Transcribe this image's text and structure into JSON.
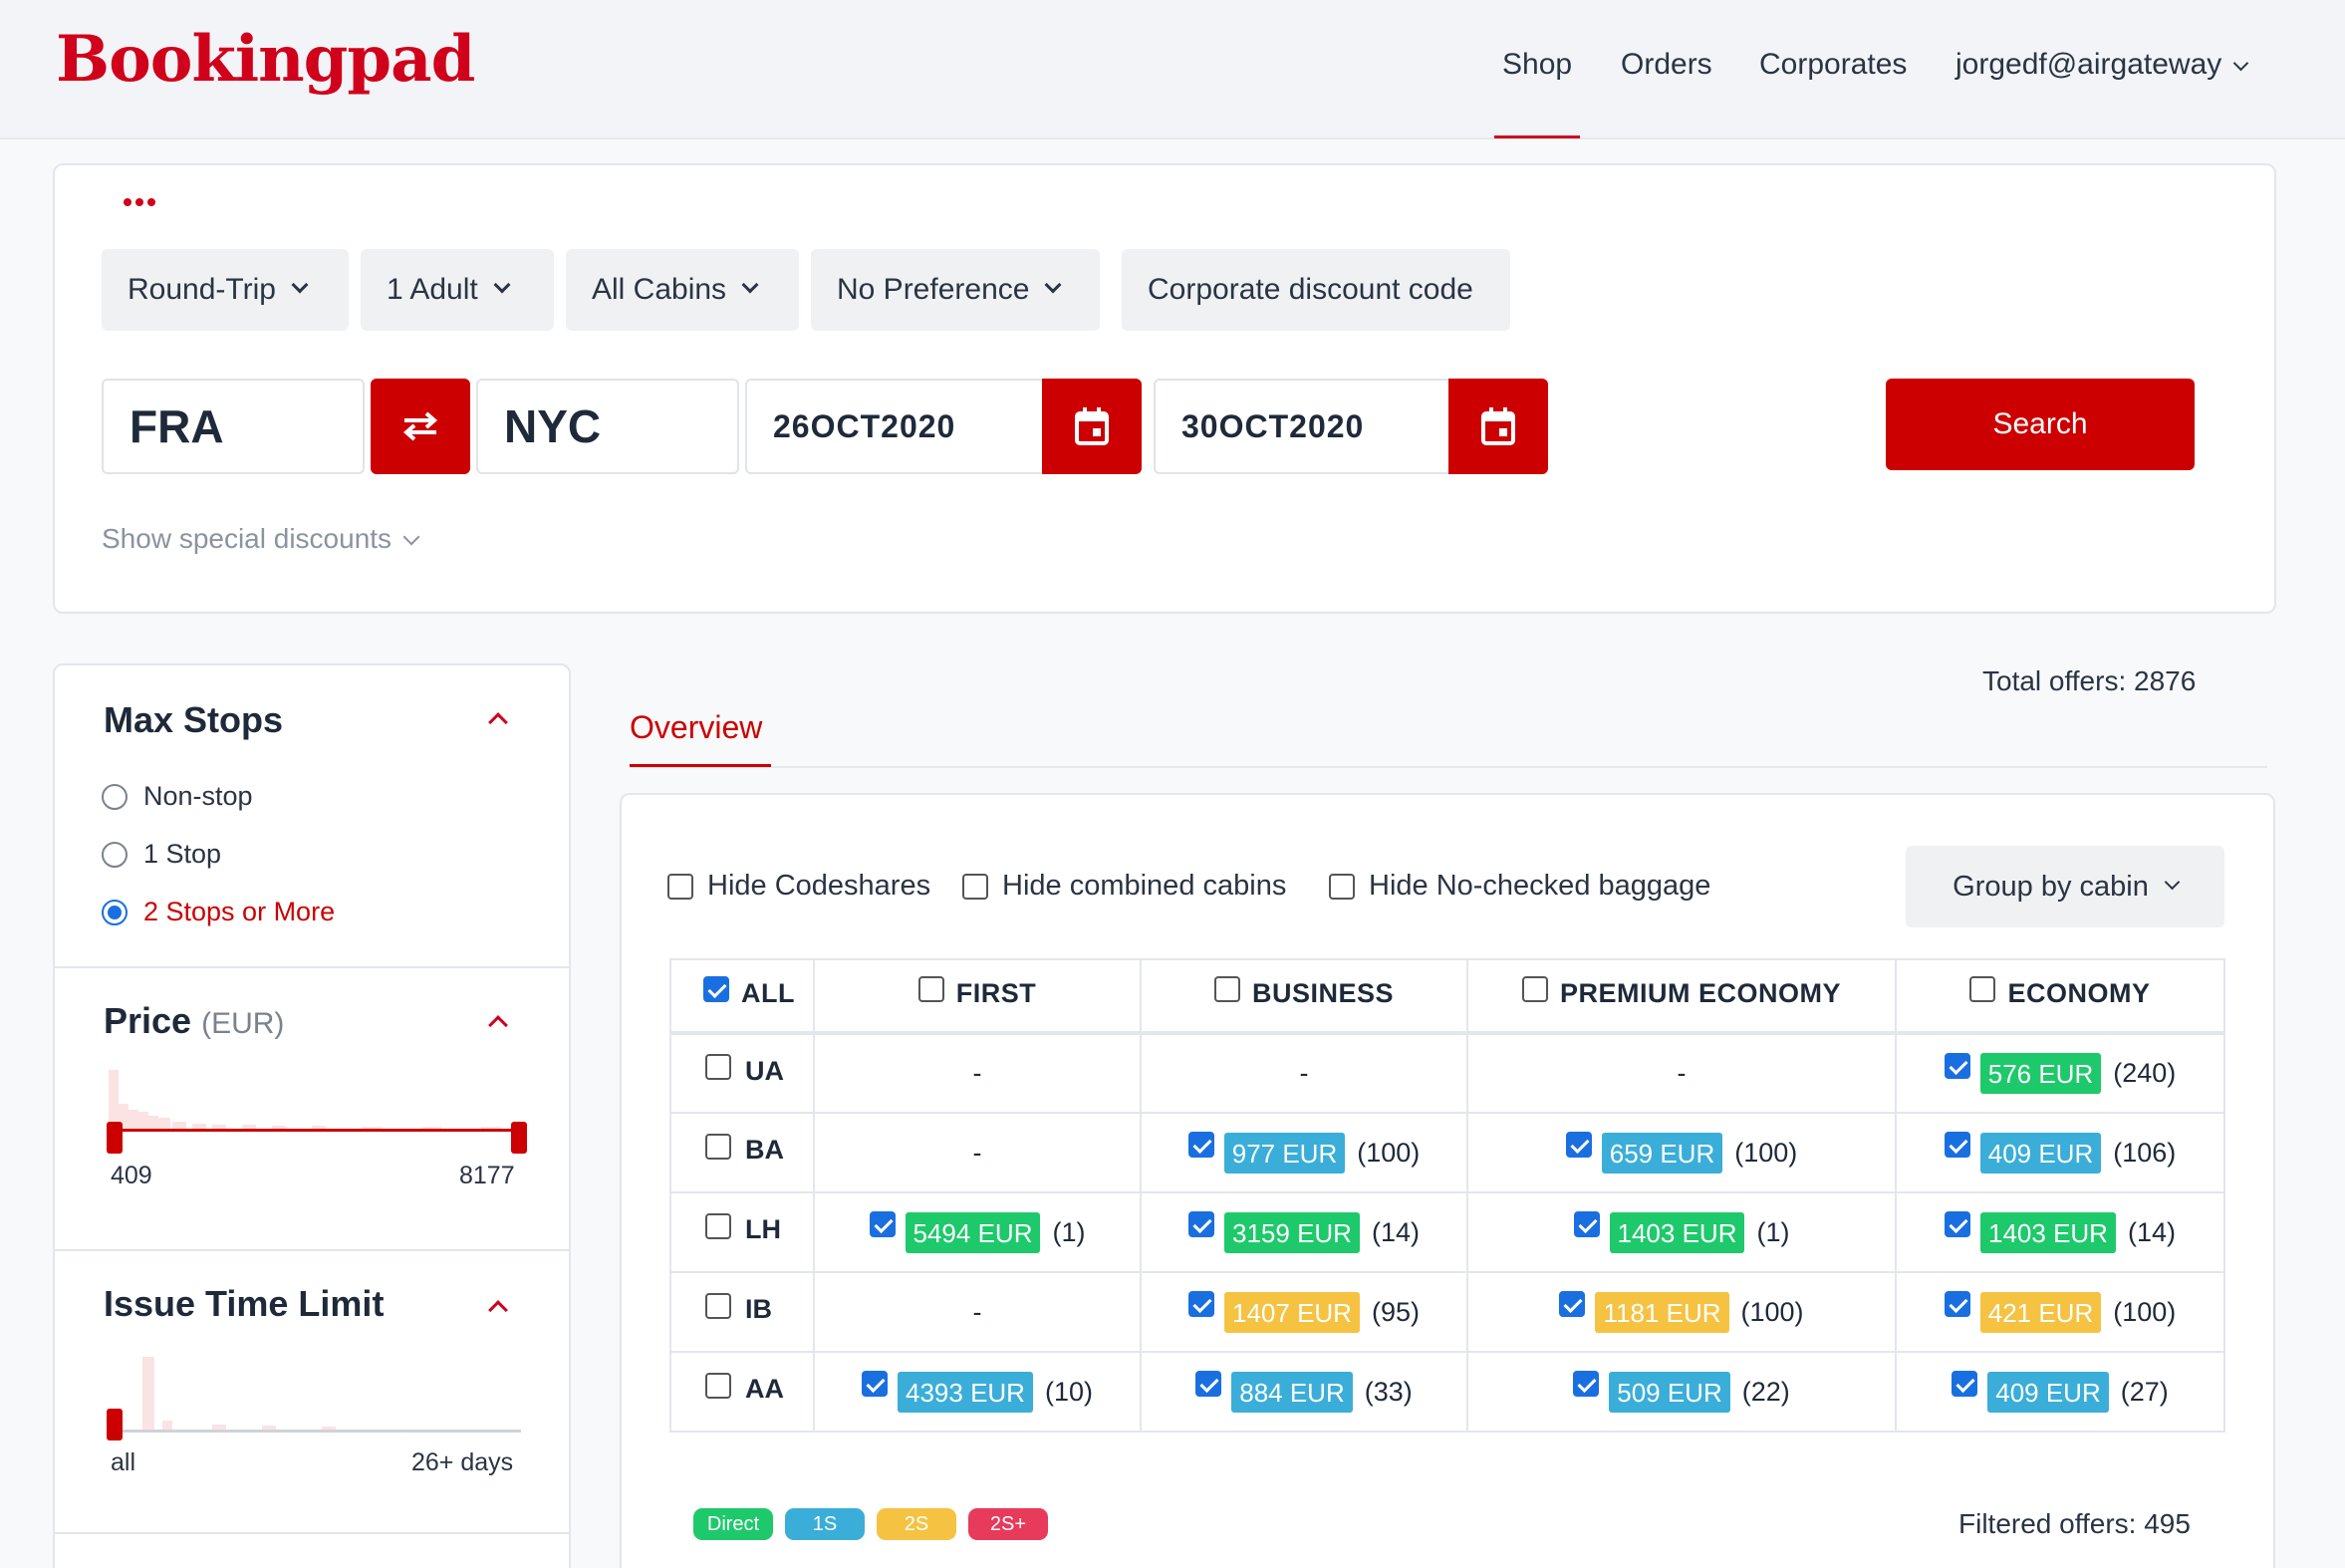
{
  "header": {
    "logo": "Bookingpad",
    "nav": [
      "Shop",
      "Orders",
      "Corporates"
    ],
    "user": "jorgedf@airgateway"
  },
  "search": {
    "trip_type": "Round-Trip",
    "passengers": "1 Adult",
    "cabin": "All Cabins",
    "preference": "No Preference",
    "corporate_code_placeholder": "Corporate discount code",
    "origin": "FRA",
    "destination": "NYC",
    "depart_date": "26OCT2020",
    "return_date": "30OCT2020",
    "search_label": "Search",
    "show_discounts": "Show special discounts"
  },
  "sidebar": {
    "max_stops": {
      "title": "Max Stops",
      "options": [
        "Non-stop",
        "1 Stop",
        "2 Stops or More"
      ],
      "selected": "2 Stops or More"
    },
    "price": {
      "title": "Price",
      "unit": "(EUR)",
      "min": "409",
      "max": "8177"
    },
    "issue_time": {
      "title": "Issue Time Limit",
      "min": "all",
      "max": "26+ days"
    }
  },
  "main": {
    "total_offers": "Total offers: 2876",
    "tab": "Overview",
    "filters": [
      "Hide Codeshares",
      "Hide combined cabins",
      "Hide No-checked baggage"
    ],
    "group_by": "Group by cabin",
    "columns": [
      "ALL",
      "FIRST",
      "BUSINESS",
      "PREMIUM ECONOMY",
      "ECONOMY"
    ],
    "rows": [
      {
        "airline": "UA",
        "cells": [
          null,
          null,
          null,
          {
            "price": "576 EUR",
            "count": "(240)",
            "color": "#1ec96b"
          }
        ]
      },
      {
        "airline": "BA",
        "cells": [
          null,
          {
            "price": "977 EUR",
            "count": "(100)",
            "color": "#3aaed8"
          },
          {
            "price": "659 EUR",
            "count": "(100)",
            "color": "#3aaed8"
          },
          {
            "price": "409 EUR",
            "count": "(106)",
            "color": "#3aaed8"
          }
        ]
      },
      {
        "airline": "LH",
        "cells": [
          {
            "price": "5494 EUR",
            "count": "(1)",
            "color": "#1ec96b"
          },
          {
            "price": "3159 EUR",
            "count": "(14)",
            "color": "#1ec96b"
          },
          {
            "price": "1403 EUR",
            "count": "(1)",
            "color": "#1ec96b"
          },
          {
            "price": "1403 EUR",
            "count": "(14)",
            "color": "#1ec96b"
          }
        ]
      },
      {
        "airline": "IB",
        "cells": [
          null,
          {
            "price": "1407 EUR",
            "count": "(95)",
            "color": "#f5c242"
          },
          {
            "price": "1181 EUR",
            "count": "(100)",
            "color": "#f5c242"
          },
          {
            "price": "421 EUR",
            "count": "(100)",
            "color": "#f5c242"
          }
        ]
      },
      {
        "airline": "AA",
        "cells": [
          {
            "price": "4393 EUR",
            "count": "(10)",
            "color": "#3aaed8"
          },
          {
            "price": "884 EUR",
            "count": "(33)",
            "color": "#3aaed8"
          },
          {
            "price": "509 EUR",
            "count": "(22)",
            "color": "#3aaed8"
          },
          {
            "price": "409 EUR",
            "count": "(27)",
            "color": "#3aaed8"
          }
        ]
      }
    ],
    "empty_cell": "-",
    "legend": [
      {
        "label": "Direct",
        "color": "#1ec96b"
      },
      {
        "label": "1S",
        "color": "#3aaed8"
      },
      {
        "label": "2S",
        "color": "#f5c242"
      },
      {
        "label": "2S+",
        "color": "#e83a5a"
      }
    ],
    "filtered_offers": "Filtered offers: 495"
  },
  "colors": {
    "brand": "#d0021b",
    "button_red": "#cc0000",
    "checkbox_blue": "#1a6fe0"
  }
}
